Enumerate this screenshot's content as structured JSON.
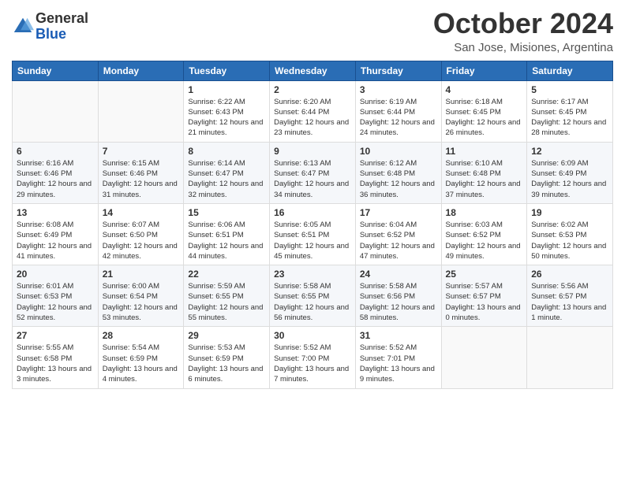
{
  "header": {
    "logo_general": "General",
    "logo_blue": "Blue",
    "month_title": "October 2024",
    "location": "San Jose, Misiones, Argentina"
  },
  "calendar": {
    "weekdays": [
      "Sunday",
      "Monday",
      "Tuesday",
      "Wednesday",
      "Thursday",
      "Friday",
      "Saturday"
    ],
    "weeks": [
      [
        {
          "day": null,
          "info": null
        },
        {
          "day": null,
          "info": null
        },
        {
          "day": "1",
          "info": "Sunrise: 6:22 AM\nSunset: 6:43 PM\nDaylight: 12 hours and 21 minutes."
        },
        {
          "day": "2",
          "info": "Sunrise: 6:20 AM\nSunset: 6:44 PM\nDaylight: 12 hours and 23 minutes."
        },
        {
          "day": "3",
          "info": "Sunrise: 6:19 AM\nSunset: 6:44 PM\nDaylight: 12 hours and 24 minutes."
        },
        {
          "day": "4",
          "info": "Sunrise: 6:18 AM\nSunset: 6:45 PM\nDaylight: 12 hours and 26 minutes."
        },
        {
          "day": "5",
          "info": "Sunrise: 6:17 AM\nSunset: 6:45 PM\nDaylight: 12 hours and 28 minutes."
        }
      ],
      [
        {
          "day": "6",
          "info": "Sunrise: 6:16 AM\nSunset: 6:46 PM\nDaylight: 12 hours and 29 minutes."
        },
        {
          "day": "7",
          "info": "Sunrise: 6:15 AM\nSunset: 6:46 PM\nDaylight: 12 hours and 31 minutes."
        },
        {
          "day": "8",
          "info": "Sunrise: 6:14 AM\nSunset: 6:47 PM\nDaylight: 12 hours and 32 minutes."
        },
        {
          "day": "9",
          "info": "Sunrise: 6:13 AM\nSunset: 6:47 PM\nDaylight: 12 hours and 34 minutes."
        },
        {
          "day": "10",
          "info": "Sunrise: 6:12 AM\nSunset: 6:48 PM\nDaylight: 12 hours and 36 minutes."
        },
        {
          "day": "11",
          "info": "Sunrise: 6:10 AM\nSunset: 6:48 PM\nDaylight: 12 hours and 37 minutes."
        },
        {
          "day": "12",
          "info": "Sunrise: 6:09 AM\nSunset: 6:49 PM\nDaylight: 12 hours and 39 minutes."
        }
      ],
      [
        {
          "day": "13",
          "info": "Sunrise: 6:08 AM\nSunset: 6:49 PM\nDaylight: 12 hours and 41 minutes."
        },
        {
          "day": "14",
          "info": "Sunrise: 6:07 AM\nSunset: 6:50 PM\nDaylight: 12 hours and 42 minutes."
        },
        {
          "day": "15",
          "info": "Sunrise: 6:06 AM\nSunset: 6:51 PM\nDaylight: 12 hours and 44 minutes."
        },
        {
          "day": "16",
          "info": "Sunrise: 6:05 AM\nSunset: 6:51 PM\nDaylight: 12 hours and 45 minutes."
        },
        {
          "day": "17",
          "info": "Sunrise: 6:04 AM\nSunset: 6:52 PM\nDaylight: 12 hours and 47 minutes."
        },
        {
          "day": "18",
          "info": "Sunrise: 6:03 AM\nSunset: 6:52 PM\nDaylight: 12 hours and 49 minutes."
        },
        {
          "day": "19",
          "info": "Sunrise: 6:02 AM\nSunset: 6:53 PM\nDaylight: 12 hours and 50 minutes."
        }
      ],
      [
        {
          "day": "20",
          "info": "Sunrise: 6:01 AM\nSunset: 6:53 PM\nDaylight: 12 hours and 52 minutes."
        },
        {
          "day": "21",
          "info": "Sunrise: 6:00 AM\nSunset: 6:54 PM\nDaylight: 12 hours and 53 minutes."
        },
        {
          "day": "22",
          "info": "Sunrise: 5:59 AM\nSunset: 6:55 PM\nDaylight: 12 hours and 55 minutes."
        },
        {
          "day": "23",
          "info": "Sunrise: 5:58 AM\nSunset: 6:55 PM\nDaylight: 12 hours and 56 minutes."
        },
        {
          "day": "24",
          "info": "Sunrise: 5:58 AM\nSunset: 6:56 PM\nDaylight: 12 hours and 58 minutes."
        },
        {
          "day": "25",
          "info": "Sunrise: 5:57 AM\nSunset: 6:57 PM\nDaylight: 13 hours and 0 minutes."
        },
        {
          "day": "26",
          "info": "Sunrise: 5:56 AM\nSunset: 6:57 PM\nDaylight: 13 hours and 1 minute."
        }
      ],
      [
        {
          "day": "27",
          "info": "Sunrise: 5:55 AM\nSunset: 6:58 PM\nDaylight: 13 hours and 3 minutes."
        },
        {
          "day": "28",
          "info": "Sunrise: 5:54 AM\nSunset: 6:59 PM\nDaylight: 13 hours and 4 minutes."
        },
        {
          "day": "29",
          "info": "Sunrise: 5:53 AM\nSunset: 6:59 PM\nDaylight: 13 hours and 6 minutes."
        },
        {
          "day": "30",
          "info": "Sunrise: 5:52 AM\nSunset: 7:00 PM\nDaylight: 13 hours and 7 minutes."
        },
        {
          "day": "31",
          "info": "Sunrise: 5:52 AM\nSunset: 7:01 PM\nDaylight: 13 hours and 9 minutes."
        },
        {
          "day": null,
          "info": null
        },
        {
          "day": null,
          "info": null
        }
      ]
    ]
  }
}
